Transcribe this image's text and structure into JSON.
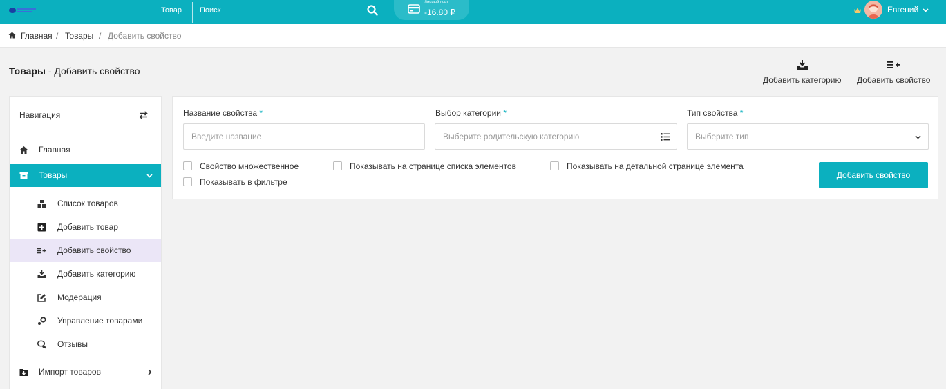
{
  "topbar": {
    "tab_product": "Товар",
    "tab_search": "Поиск",
    "balance_label": "Личный счет",
    "balance_amount": "-16.80 ₽",
    "user_name": "Евгений"
  },
  "breadcrumb": {
    "home": "Главная",
    "separator": "/",
    "products": "Товары",
    "current": "Добавить свойство"
  },
  "page": {
    "title_bold": "Товары",
    "title_rest": " - Добавить свойство"
  },
  "actions": {
    "add_category": "Добавить категорию",
    "add_property": "Добавить свойство"
  },
  "sidebar": {
    "heading": "Навигация",
    "home": "Главная",
    "products": "Товары",
    "sub": [
      "Список товаров",
      "Добавить товар",
      "Добавить свойство",
      "Добавить категорию",
      "Модерация",
      "Управление товарами",
      "Отзывы"
    ],
    "import": "Импорт товаров"
  },
  "form": {
    "name_label": "Название свойства",
    "name_placeholder": "Введите название",
    "category_label": "Выбор категории",
    "category_placeholder": "Выберите родительскую категорию",
    "type_label": "Тип свойства",
    "type_placeholder": "Выберите тип",
    "required_mark": "*",
    "cb_multiple": "Свойство множественное",
    "cb_list_page": "Показывать на странице списка элементов",
    "cb_detail_page": "Показывать на детальной странице элемента",
    "cb_filter": "Показывать в фильтре",
    "submit": "Добавить свойство"
  },
  "colors": {
    "accent": "#0bb0bf",
    "selected_bg": "#ebe6f7"
  }
}
